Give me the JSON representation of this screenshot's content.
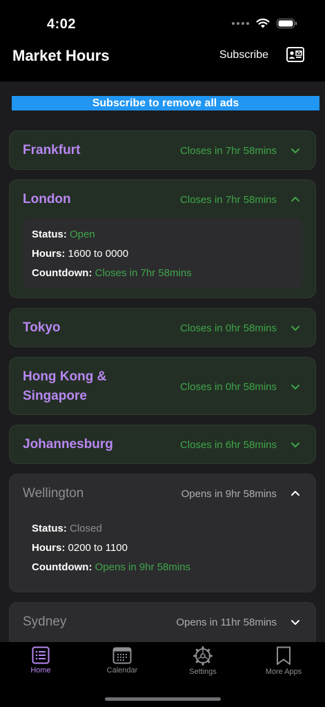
{
  "status_bar": {
    "time": "4:02"
  },
  "header": {
    "title": "Market Hours",
    "subscribe_label": "Subscribe"
  },
  "ad_banner": {
    "text": "Subscribe to remove all ads"
  },
  "markets": [
    {
      "city": "Frankfurt",
      "state": "Closes in 7hr 58mins",
      "open": true,
      "expanded": false
    },
    {
      "city": "London",
      "state": "Closes in 7hr 58mins",
      "open": true,
      "expanded": true,
      "status_label": "Status:",
      "status_value": "Open",
      "hours_label": "Hours:",
      "hours_value": "1600 to 0000",
      "countdown_label": "Countdown:",
      "countdown_value": "Closes in 7hr 58mins"
    },
    {
      "city": "Tokyo",
      "state": "Closes in 0hr 58mins",
      "open": true,
      "expanded": false
    },
    {
      "city_line1": "Hong Kong &",
      "city_line2": "Singapore",
      "state": "Closes in 0hr 58mins",
      "open": true,
      "expanded": false
    },
    {
      "city": "Johannesburg",
      "state": "Closes in 6hr 58mins",
      "open": true,
      "expanded": false
    },
    {
      "city": "Wellington",
      "state": "Opens in 9hr 58mins",
      "open": false,
      "expanded": true,
      "status_label": "Status:",
      "status_value": "Closed",
      "hours_label": "Hours:",
      "hours_value": "0200 to 1100",
      "countdown_label": "Countdown:",
      "countdown_value": "Opens in 9hr 58mins"
    },
    {
      "city": "Sydney",
      "state": "Opens in 11hr 58mins",
      "open": false,
      "expanded": false
    }
  ],
  "tabs": [
    {
      "label": "Home",
      "icon": "list-icon",
      "active": true
    },
    {
      "label": "Calendar",
      "icon": "calendar-icon",
      "active": false
    },
    {
      "label": "Settings",
      "icon": "gear-icon",
      "active": false
    },
    {
      "label": "More Apps",
      "icon": "bookmark-icon",
      "active": false
    }
  ],
  "colors": {
    "accent": "#b887f2",
    "open_green": "#3fa54a",
    "banner_blue": "#2196f3"
  }
}
